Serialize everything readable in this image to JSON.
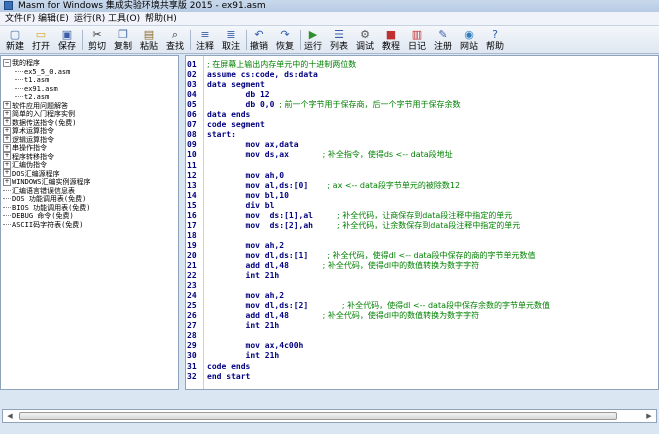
{
  "window": {
    "title": "Masm for Windows 集成实验环境共享版 2015  -  ex91.asm"
  },
  "menu": [
    "文件(F)",
    "编辑(E)",
    "运行(R)",
    "工具(O)",
    "帮助(H)"
  ],
  "toolbar": [
    {
      "label": "新建",
      "icon": "new-file-icon",
      "glyph": "▢",
      "color": "#4a6fa5"
    },
    {
      "label": "打开",
      "icon": "open-folder-icon",
      "glyph": "▭",
      "color": "#d9a521"
    },
    {
      "label": "保存",
      "icon": "save-icon",
      "glyph": "▣",
      "color": "#3b5ea8"
    },
    {
      "label": "剪切",
      "icon": "cut-icon",
      "glyph": "✂",
      "color": "#333333"
    },
    {
      "label": "复制",
      "icon": "copy-icon",
      "glyph": "❐",
      "color": "#4a6fa5"
    },
    {
      "label": "粘贴",
      "icon": "paste-icon",
      "glyph": "▤",
      "color": "#8a6a2a"
    },
    {
      "label": "查找",
      "icon": "find-icon",
      "glyph": "⌕",
      "color": "#333333"
    },
    {
      "label": "注释",
      "icon": "comment-icon",
      "glyph": "≡",
      "color": "#3b5ea8"
    },
    {
      "label": "取注",
      "icon": "uncomment-icon",
      "glyph": "≣",
      "color": "#3b5ea8"
    },
    {
      "label": "撤销",
      "icon": "undo-icon",
      "glyph": "↶",
      "color": "#2f5fb0"
    },
    {
      "label": "恢复",
      "icon": "redo-icon",
      "glyph": "↷",
      "color": "#2f5fb0"
    },
    {
      "label": "运行",
      "icon": "run-icon",
      "glyph": "▶",
      "color": "#2f8f2f"
    },
    {
      "label": "列表",
      "icon": "list-icon",
      "glyph": "☰",
      "color": "#3b5ea8"
    },
    {
      "label": "调试",
      "icon": "debug-icon",
      "glyph": "⚙",
      "color": "#555555"
    },
    {
      "label": "教程",
      "icon": "tutorial-icon",
      "glyph": "■",
      "color": "#c03030"
    },
    {
      "label": "日记",
      "icon": "diary-icon",
      "glyph": "▥",
      "color": "#c03030"
    },
    {
      "label": "注册",
      "icon": "register-icon",
      "glyph": "✎",
      "color": "#3b5ea8"
    },
    {
      "label": "网站",
      "icon": "website-icon",
      "glyph": "◉",
      "color": "#2f7fc0"
    },
    {
      "label": "帮助",
      "icon": "help-icon",
      "glyph": "?",
      "color": "#2f5fb0"
    }
  ],
  "tree": [
    {
      "label": "我的程序",
      "level": 0,
      "toggle": "−"
    },
    {
      "label": "ex5_5_0.asm",
      "level": 1,
      "toggle": ""
    },
    {
      "label": "t1.asm",
      "level": 1,
      "toggle": ""
    },
    {
      "label": "ex91.asm",
      "level": 1,
      "toggle": ""
    },
    {
      "label": "t2.asm",
      "level": 1,
      "toggle": ""
    },
    {
      "label": "软件应用问题解答",
      "level": 0,
      "toggle": "+"
    },
    {
      "label": "简单的入门程序实例",
      "level": 0,
      "toggle": "+"
    },
    {
      "label": "数据传送指令(免费)",
      "level": 0,
      "toggle": "+"
    },
    {
      "label": "算术运算指令",
      "level": 0,
      "toggle": "+"
    },
    {
      "label": "逻辑运算指令",
      "level": 0,
      "toggle": "+"
    },
    {
      "label": "串操作指令",
      "level": 0,
      "toggle": "+"
    },
    {
      "label": "程序转移指令",
      "level": 0,
      "toggle": "+"
    },
    {
      "label": "汇编伪指令",
      "level": 0,
      "toggle": "+"
    },
    {
      "label": "DOS汇编源程序",
      "level": 0,
      "toggle": "+"
    },
    {
      "label": "WINDOWS汇编实例源程序",
      "level": 0,
      "toggle": "+"
    },
    {
      "label": "汇编语言错误信息表",
      "level": 0,
      "toggle": ""
    },
    {
      "label": "DOS 功能调用表(免费)",
      "level": 0,
      "toggle": ""
    },
    {
      "label": "BIOS 功能调用表(免费)",
      "level": 0,
      "toggle": ""
    },
    {
      "label": "DEBUG 命令(免费)",
      "level": 0,
      "toggle": ""
    },
    {
      "label": "ASCII码字符表(免费)",
      "level": 0,
      "toggle": ""
    }
  ],
  "code": [
    {
      "n": "01",
      "t": "; 在屏幕上输出内存单元中的十进制两位数",
      "c": ""
    },
    {
      "n": "02",
      "t": "assume cs:code, ds:data",
      "c": ""
    },
    {
      "n": "03",
      "t": "data segment",
      "c": ""
    },
    {
      "n": "04",
      "t": "        db 12",
      "c": ""
    },
    {
      "n": "05",
      "t": "        db 0,0 ",
      "c": "; 前一个字节用于保存商，后一个字节用于保存余数"
    },
    {
      "n": "06",
      "t": "data ends",
      "c": ""
    },
    {
      "n": "07",
      "t": "code segment",
      "c": ""
    },
    {
      "n": "08",
      "t": "start:",
      "c": ""
    },
    {
      "n": "09",
      "t": "        mov ax,data",
      "c": ""
    },
    {
      "n": "10",
      "t": "        mov ds,ax       ",
      "c": "; 补全指令，使得ds <-- data段地址"
    },
    {
      "n": "11",
      "t": "",
      "c": ""
    },
    {
      "n": "12",
      "t": "        mov ah,0",
      "c": ""
    },
    {
      "n": "13",
      "t": "        mov al,ds:[0]    ",
      "c": "; ax <-- data段字节单元的被除数12"
    },
    {
      "n": "14",
      "t": "        mov bl,10",
      "c": ""
    },
    {
      "n": "15",
      "t": "        div bl",
      "c": ""
    },
    {
      "n": "16",
      "t": "        mov  ds:[1],al     ",
      "c": "; 补全代码，让商保存到data段注释中指定的单元"
    },
    {
      "n": "17",
      "t": "        mov  ds:[2],ah     ",
      "c": "; 补全代码，让余数保存到data段注释中指定的单元"
    },
    {
      "n": "18",
      "t": "",
      "c": ""
    },
    {
      "n": "19",
      "t": "        mov ah,2",
      "c": ""
    },
    {
      "n": "20",
      "t": "        mov dl,ds:[1]    ",
      "c": "; 补全代码，使得dl <-- data段中保存的商的字节单元数值"
    },
    {
      "n": "21",
      "t": "        add dl,48       ",
      "c": "; 补全代码，使得dl中的数值转换为数字字符"
    },
    {
      "n": "22",
      "t": "        int 21h",
      "c": ""
    },
    {
      "n": "23",
      "t": "",
      "c": ""
    },
    {
      "n": "24",
      "t": "        mov ah,2",
      "c": ""
    },
    {
      "n": "25",
      "t": "        mov dl,ds:[2]       ",
      "c": "; 补全代码，使得dl <-- data段中保存余数的字节单元数值"
    },
    {
      "n": "26",
      "t": "        add dl,48       ",
      "c": "; 补全代码，使得dl中的数值转换为数字字符"
    },
    {
      "n": "27",
      "t": "        int 21h",
      "c": ""
    },
    {
      "n": "28",
      "t": "",
      "c": ""
    },
    {
      "n": "29",
      "t": "        mov ax,4c00h",
      "c": ""
    },
    {
      "n": "30",
      "t": "        int 21h",
      "c": ""
    },
    {
      "n": "31",
      "t": "code ends",
      "c": ""
    },
    {
      "n": "32",
      "t": "end start",
      "c": ""
    }
  ]
}
